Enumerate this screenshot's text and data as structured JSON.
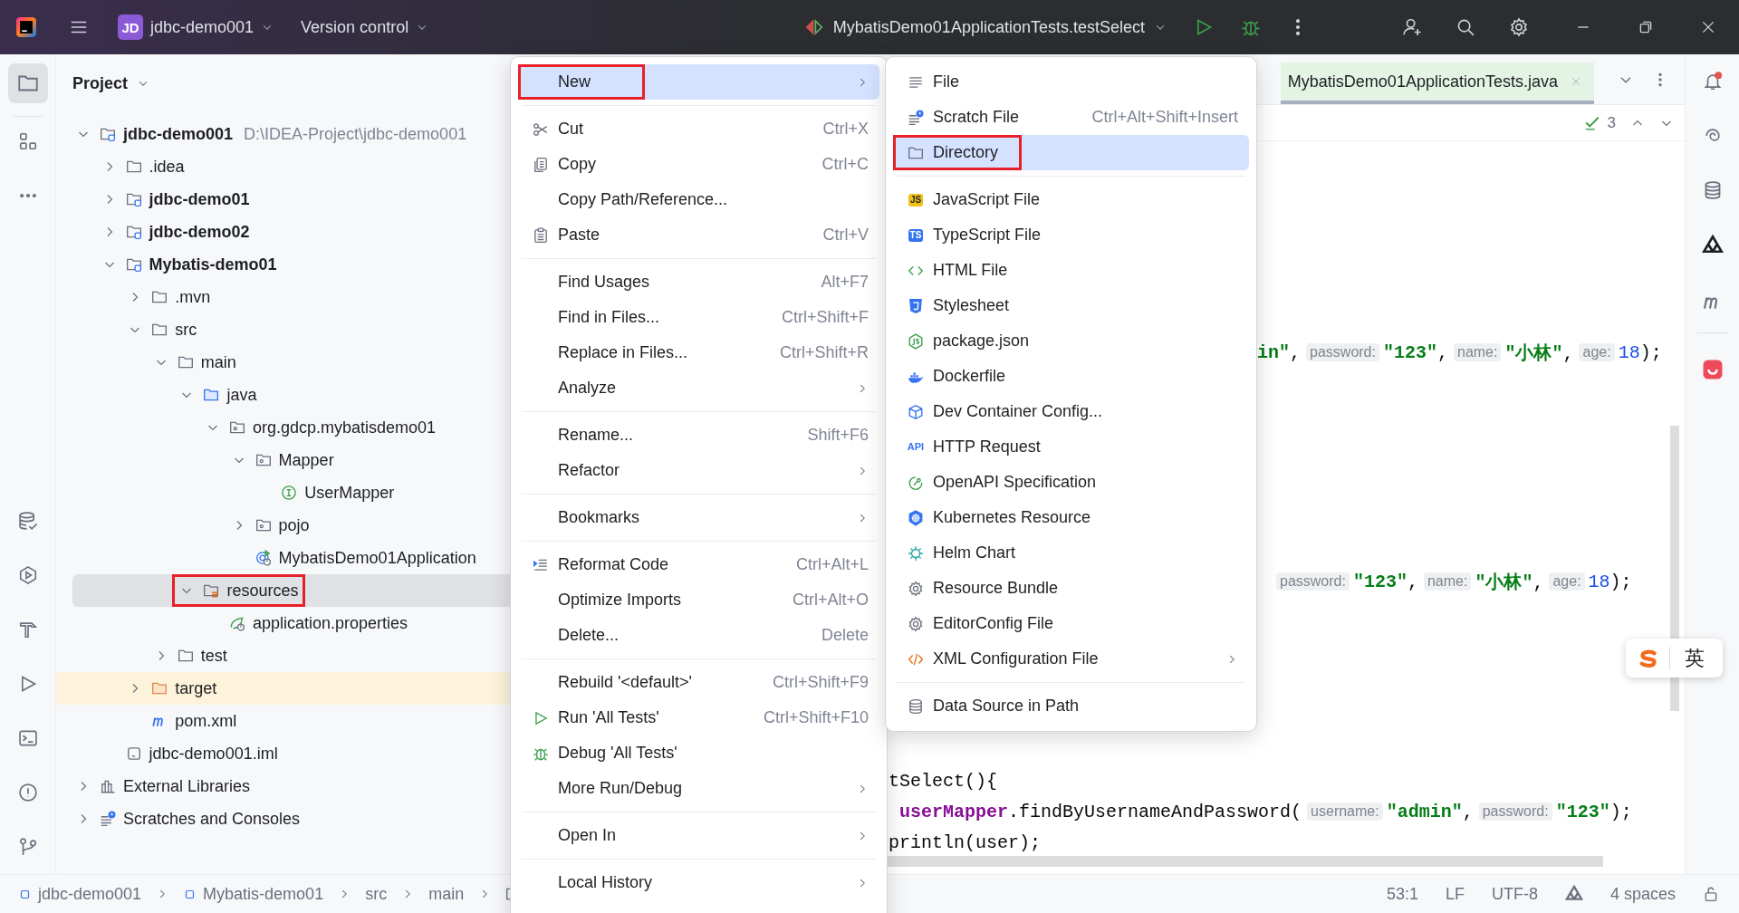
{
  "title_bar": {
    "project_badge": "JD",
    "project": "jdbc-demo001",
    "vcs": "Version control",
    "run_config": "MybatisDemo01ApplicationTests.testSelect"
  },
  "project": {
    "title": "Project",
    "tree": [
      {
        "label": "jdbc-demo001",
        "kind": "module",
        "path": "D:\\IDEA-Project\\jdbc-demo001",
        "expanded": true,
        "selected": false,
        "outlined": false,
        "children": [
          {
            "label": ".idea",
            "kind": "folder",
            "expanded": false,
            "selected": false,
            "outlined": false
          },
          {
            "label": "jdbc-demo01",
            "kind": "module",
            "expanded": false,
            "selected": false,
            "outlined": false
          },
          {
            "label": "jdbc-demo02",
            "kind": "module",
            "expanded": false,
            "selected": false,
            "outlined": false
          },
          {
            "label": "Mybatis-demo01",
            "kind": "module",
            "expanded": true,
            "selected": false,
            "outlined": false,
            "children": [
              {
                "label": ".mvn",
                "kind": "folder",
                "expanded": false,
                "selected": false,
                "outlined": false
              },
              {
                "label": "src",
                "kind": "folder",
                "expanded": true,
                "selected": false,
                "outlined": false,
                "children": [
                  {
                    "label": "main",
                    "kind": "folder",
                    "expanded": true,
                    "selected": false,
                    "outlined": false,
                    "children": [
                      {
                        "label": "java",
                        "kind": "source-folder",
                        "expanded": true,
                        "selected": false,
                        "outlined": false,
                        "children": [
                          {
                            "label": "org.gdcp.mybatisdemo01",
                            "kind": "package",
                            "expanded": true,
                            "selected": false,
                            "outlined": false,
                            "children": [
                              {
                                "label": "Mapper",
                                "kind": "package",
                                "expanded": true,
                                "selected": false,
                                "outlined": false,
                                "children": [
                                  {
                                    "label": "UserMapper",
                                    "kind": "interface",
                                    "selected": false,
                                    "outlined": false
                                  }
                                ]
                              },
                              {
                                "label": "pojo",
                                "kind": "package",
                                "expanded": false,
                                "selected": false,
                                "outlined": false
                              },
                              {
                                "label": "MybatisDemo01Application",
                                "kind": "spring-app",
                                "selected": false,
                                "outlined": false
                              }
                            ]
                          }
                        ]
                      },
                      {
                        "label": "resources",
                        "kind": "resource-folder",
                        "expanded": true,
                        "selected": true,
                        "outlined": true,
                        "children": [
                          {
                            "label": "application.properties",
                            "kind": "properties",
                            "selected": false,
                            "outlined": false
                          }
                        ]
                      }
                    ]
                  },
                  {
                    "label": "test",
                    "kind": "folder",
                    "expanded": false,
                    "selected": false,
                    "outlined": false
                  }
                ]
              },
              {
                "label": "target",
                "kind": "excluded-folder",
                "expanded": false,
                "selected": false,
                "outlined": false
              },
              {
                "label": "pom.xml",
                "kind": "maven",
                "selected": false,
                "outlined": false
              }
            ]
          },
          {
            "label": "jdbc-demo001.iml",
            "kind": "iml",
            "selected": false,
            "outlined": false
          }
        ]
      },
      {
        "label": "External Libraries",
        "kind": "libraries",
        "expanded": false,
        "selected": false,
        "outlined": false
      },
      {
        "label": "Scratches and Consoles",
        "kind": "scratches",
        "expanded": false,
        "selected": false,
        "outlined": false
      }
    ]
  },
  "context_menu": {
    "items": [
      {
        "kind": "plain",
        "label": "New",
        "submenu": true,
        "selected": true,
        "outlined": true
      },
      {
        "kind": "separator"
      },
      {
        "kind": "cut",
        "label": "Cut",
        "shortcut": "Ctrl+X",
        "submenu": false,
        "selected": false,
        "outlined": false
      },
      {
        "kind": "copy",
        "label": "Copy",
        "shortcut": "Ctrl+C",
        "submenu": false,
        "selected": false,
        "outlined": false
      },
      {
        "kind": "plain",
        "label": "Copy Path/Reference...",
        "submenu": false,
        "selected": false,
        "outlined": false
      },
      {
        "kind": "paste",
        "label": "Paste",
        "shortcut": "Ctrl+V",
        "submenu": false,
        "selected": false,
        "outlined": false
      },
      {
        "kind": "separator"
      },
      {
        "kind": "plain",
        "label": "Find Usages",
        "shortcut": "Alt+F7",
        "submenu": false,
        "selected": false,
        "outlined": false
      },
      {
        "kind": "plain",
        "label": "Find in Files...",
        "shortcut": "Ctrl+Shift+F",
        "submenu": false,
        "selected": false,
        "outlined": false
      },
      {
        "kind": "plain",
        "label": "Replace in Files...",
        "shortcut": "Ctrl+Shift+R",
        "submenu": false,
        "selected": false,
        "outlined": false
      },
      {
        "kind": "plain",
        "label": "Analyze",
        "submenu": true,
        "selected": false,
        "outlined": false
      },
      {
        "kind": "separator"
      },
      {
        "kind": "plain",
        "label": "Rename...",
        "shortcut": "Shift+F6",
        "submenu": false,
        "selected": false,
        "outlined": false
      },
      {
        "kind": "plain",
        "label": "Refactor",
        "submenu": true,
        "selected": false,
        "outlined": false
      },
      {
        "kind": "separator"
      },
      {
        "kind": "plain",
        "label": "Bookmarks",
        "submenu": true,
        "selected": false,
        "outlined": false
      },
      {
        "kind": "separator"
      },
      {
        "kind": "reformat",
        "label": "Reformat Code",
        "shortcut": "Ctrl+Alt+L",
        "submenu": false,
        "selected": false,
        "outlined": false
      },
      {
        "kind": "plain",
        "label": "Optimize Imports",
        "shortcut": "Ctrl+Alt+O",
        "submenu": false,
        "selected": false,
        "outlined": false
      },
      {
        "kind": "plain",
        "label": "Delete...",
        "shortcut": "Delete",
        "submenu": false,
        "selected": false,
        "outlined": false
      },
      {
        "kind": "separator"
      },
      {
        "kind": "plain",
        "label": "Rebuild '<default>'",
        "shortcut": "Ctrl+Shift+F9",
        "submenu": false,
        "selected": false,
        "outlined": false
      },
      {
        "kind": "run",
        "label": "Run 'All Tests'",
        "shortcut": "Ctrl+Shift+F10",
        "submenu": false,
        "selected": false,
        "outlined": false
      },
      {
        "kind": "debug",
        "label": "Debug 'All Tests'",
        "submenu": false,
        "selected": false,
        "outlined": false
      },
      {
        "kind": "plain",
        "label": "More Run/Debug",
        "submenu": true,
        "selected": false,
        "outlined": false
      },
      {
        "kind": "separator"
      },
      {
        "kind": "plain",
        "label": "Open In",
        "submenu": true,
        "selected": false,
        "outlined": false
      },
      {
        "kind": "separator"
      },
      {
        "kind": "plain",
        "label": "Local History",
        "submenu": true,
        "selected": false,
        "outlined": false
      }
    ]
  },
  "new_submenu": {
    "items": [
      {
        "kind": "file",
        "label": "File",
        "submenu": false,
        "selected": false,
        "outlined": false
      },
      {
        "kind": "scratch",
        "label": "Scratch File",
        "shortcut": "Ctrl+Alt+Shift+Insert",
        "submenu": false,
        "selected": false,
        "outlined": false
      },
      {
        "kind": "directory",
        "label": "Directory",
        "submenu": false,
        "selected": true,
        "outlined": true
      },
      {
        "kind": "separator"
      },
      {
        "kind": "js",
        "badge": "JS",
        "label": "JavaScript File",
        "submenu": false,
        "selected": false,
        "outlined": false
      },
      {
        "kind": "ts",
        "badge": "TS",
        "label": "TypeScript File",
        "submenu": false,
        "selected": false,
        "outlined": false
      },
      {
        "kind": "html",
        "label": "HTML File",
        "submenu": false,
        "selected": false,
        "outlined": false
      },
      {
        "kind": "css",
        "label": "Stylesheet",
        "submenu": false,
        "selected": false,
        "outlined": false
      },
      {
        "kind": "node",
        "label": "package.json",
        "submenu": false,
        "selected": false,
        "outlined": false
      },
      {
        "kind": "docker",
        "label": "Dockerfile",
        "submenu": false,
        "selected": false,
        "outlined": false
      },
      {
        "kind": "cube",
        "label": "Dev Container Config...",
        "submenu": false,
        "selected": false,
        "outlined": false
      },
      {
        "kind": "api",
        "badge": "API",
        "label": "HTTP Request",
        "submenu": false,
        "selected": false,
        "outlined": false
      },
      {
        "kind": "openapi",
        "label": "OpenAPI Specification",
        "submenu": false,
        "selected": false,
        "outlined": false
      },
      {
        "kind": "k8s",
        "label": "Kubernetes Resource",
        "submenu": false,
        "selected": false,
        "outlined": false
      },
      {
        "kind": "helm",
        "label": "Helm Chart",
        "submenu": false,
        "selected": false,
        "outlined": false
      },
      {
        "kind": "gear",
        "label": "Resource Bundle",
        "submenu": false,
        "selected": false,
        "outlined": false
      },
      {
        "kind": "gear",
        "label": "EditorConfig File",
        "submenu": false,
        "selected": false,
        "outlined": false
      },
      {
        "kind": "xml",
        "label": "XML Configuration File",
        "submenu": true,
        "selected": false,
        "outlined": false
      },
      {
        "kind": "separator"
      },
      {
        "kind": "db",
        "label": "Data Source in Path",
        "submenu": false,
        "selected": false,
        "outlined": false
      }
    ]
  },
  "editor": {
    "tab": {
      "label": "MybatisDemo01ApplicationTests.java",
      "selected": true
    },
    "inspection_count": "3",
    "lines": [
      {
        "tokens": [
          {
            "kind": "string",
            "text": "in\""
          },
          {
            "kind": "plain",
            "text": ","
          },
          {
            "kind": "hint",
            "text": "password:"
          },
          {
            "kind": "string",
            "text": "\"123\""
          },
          {
            "kind": "plain",
            "text": ","
          },
          {
            "kind": "hint",
            "text": "name:"
          },
          {
            "kind": "string",
            "text": "\"小林\""
          },
          {
            "kind": "plain",
            "text": ","
          },
          {
            "kind": "hint",
            "text": "age:"
          },
          {
            "kind": "number",
            "text": "18"
          },
          {
            "kind": "plain",
            "text": ");"
          }
        ]
      },
      {
        "tokens": [
          {
            "kind": "hint",
            "text": "password:"
          },
          {
            "kind": "string",
            "text": "\"123\""
          },
          {
            "kind": "plain",
            "text": ","
          },
          {
            "kind": "hint",
            "text": "name:"
          },
          {
            "kind": "string",
            "text": "\"小林\""
          },
          {
            "kind": "plain",
            "text": ","
          },
          {
            "kind": "hint",
            "text": "age:"
          },
          {
            "kind": "number",
            "text": "18"
          },
          {
            "kind": "plain",
            "text": ");"
          }
        ]
      },
      {
        "tokens": [
          {
            "kind": "plain",
            "text": "tSelect(){"
          }
        ]
      },
      {
        "tokens": [
          {
            "kind": "field",
            "text": "userMapper"
          },
          {
            "kind": "plain",
            "text": ".findByUsernameAndPassword("
          },
          {
            "kind": "hint",
            "text": "username:"
          },
          {
            "kind": "string",
            "text": "\"admin\""
          },
          {
            "kind": "plain",
            "text": ","
          },
          {
            "kind": "hint",
            "text": "password:"
          },
          {
            "kind": "string",
            "text": "\"123\""
          },
          {
            "kind": "plain",
            "text": ");"
          }
        ]
      },
      {
        "tokens": [
          {
            "kind": "plain",
            "text": "println(user);"
          }
        ]
      }
    ]
  },
  "ime": {
    "mode": "英"
  },
  "status_bar": {
    "breadcrumbs": [
      {
        "kind": "module",
        "label": "jdbc-demo001"
      },
      {
        "kind": "module",
        "label": "Mybatis-demo01"
      },
      {
        "kind": "plain",
        "label": "src"
      },
      {
        "kind": "plain",
        "label": "main"
      },
      {
        "kind": "folder"
      }
    ],
    "position": "53:1",
    "line_separator": "LF",
    "encoding": "UTF-8",
    "indent": "4 spaces"
  }
}
